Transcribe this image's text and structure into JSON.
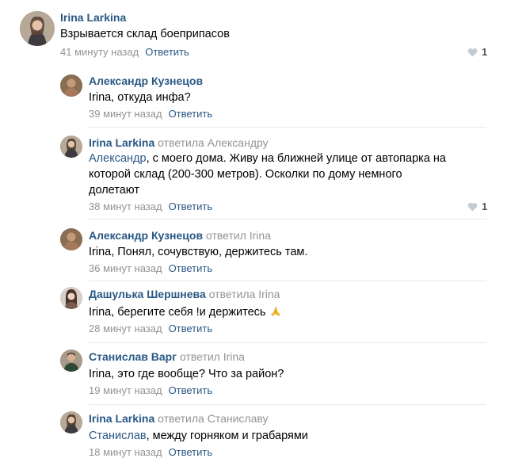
{
  "comments": [
    {
      "author": "Irina Larkina",
      "reply_to": "",
      "text": "Взрывается склад боеприпасов",
      "time": "41 минуту назад",
      "reply_label": "Ответить",
      "likes": "1"
    },
    {
      "author": "Александр Кузнецов",
      "reply_to": "",
      "mention": "",
      "text": "Irina, откуда инфа?",
      "time": "39 минут назад",
      "reply_label": "Ответить"
    },
    {
      "author": "Irina Larkina",
      "reply_to": "ответила Александру",
      "mention": "Александр",
      "text_lines": [
        ", с моего дома. Живу на ближней улице от автопарка на",
        "которой склад (200-300 метров). Осколки по дому немного",
        "долетают"
      ],
      "time": "38 минут назад",
      "reply_label": "Ответить",
      "likes": "1"
    },
    {
      "author": "Александр Кузнецов",
      "reply_to": "ответил Irina",
      "text": "Irina, Понял, сочувствую, держитесь там.",
      "time": "36 минут назад",
      "reply_label": "Ответить"
    },
    {
      "author": "Дашулька Шершнева",
      "reply_to": "ответила Irina",
      "text": "Irina, берегите себя !и держитесь",
      "time": "28 минут назад",
      "reply_label": "Ответить"
    },
    {
      "author": "Станислав Варг",
      "reply_to": "ответил Irina",
      "text": "Irina, это где вообще? Что за район?",
      "time": "19 минут назад",
      "reply_label": "Ответить"
    },
    {
      "author": "Irina Larkina",
      "reply_to": "ответила Станиславу",
      "mention": "Станислав",
      "text": ", между горняком и грабарями",
      "time": "18 минут назад",
      "reply_label": "Ответить"
    }
  ],
  "icons": {
    "like": "heart-icon",
    "emoji": "folded-hands-emoji"
  },
  "colors": {
    "link": "#2a5885",
    "meta": "#939393",
    "divider": "#e7e8ec"
  }
}
